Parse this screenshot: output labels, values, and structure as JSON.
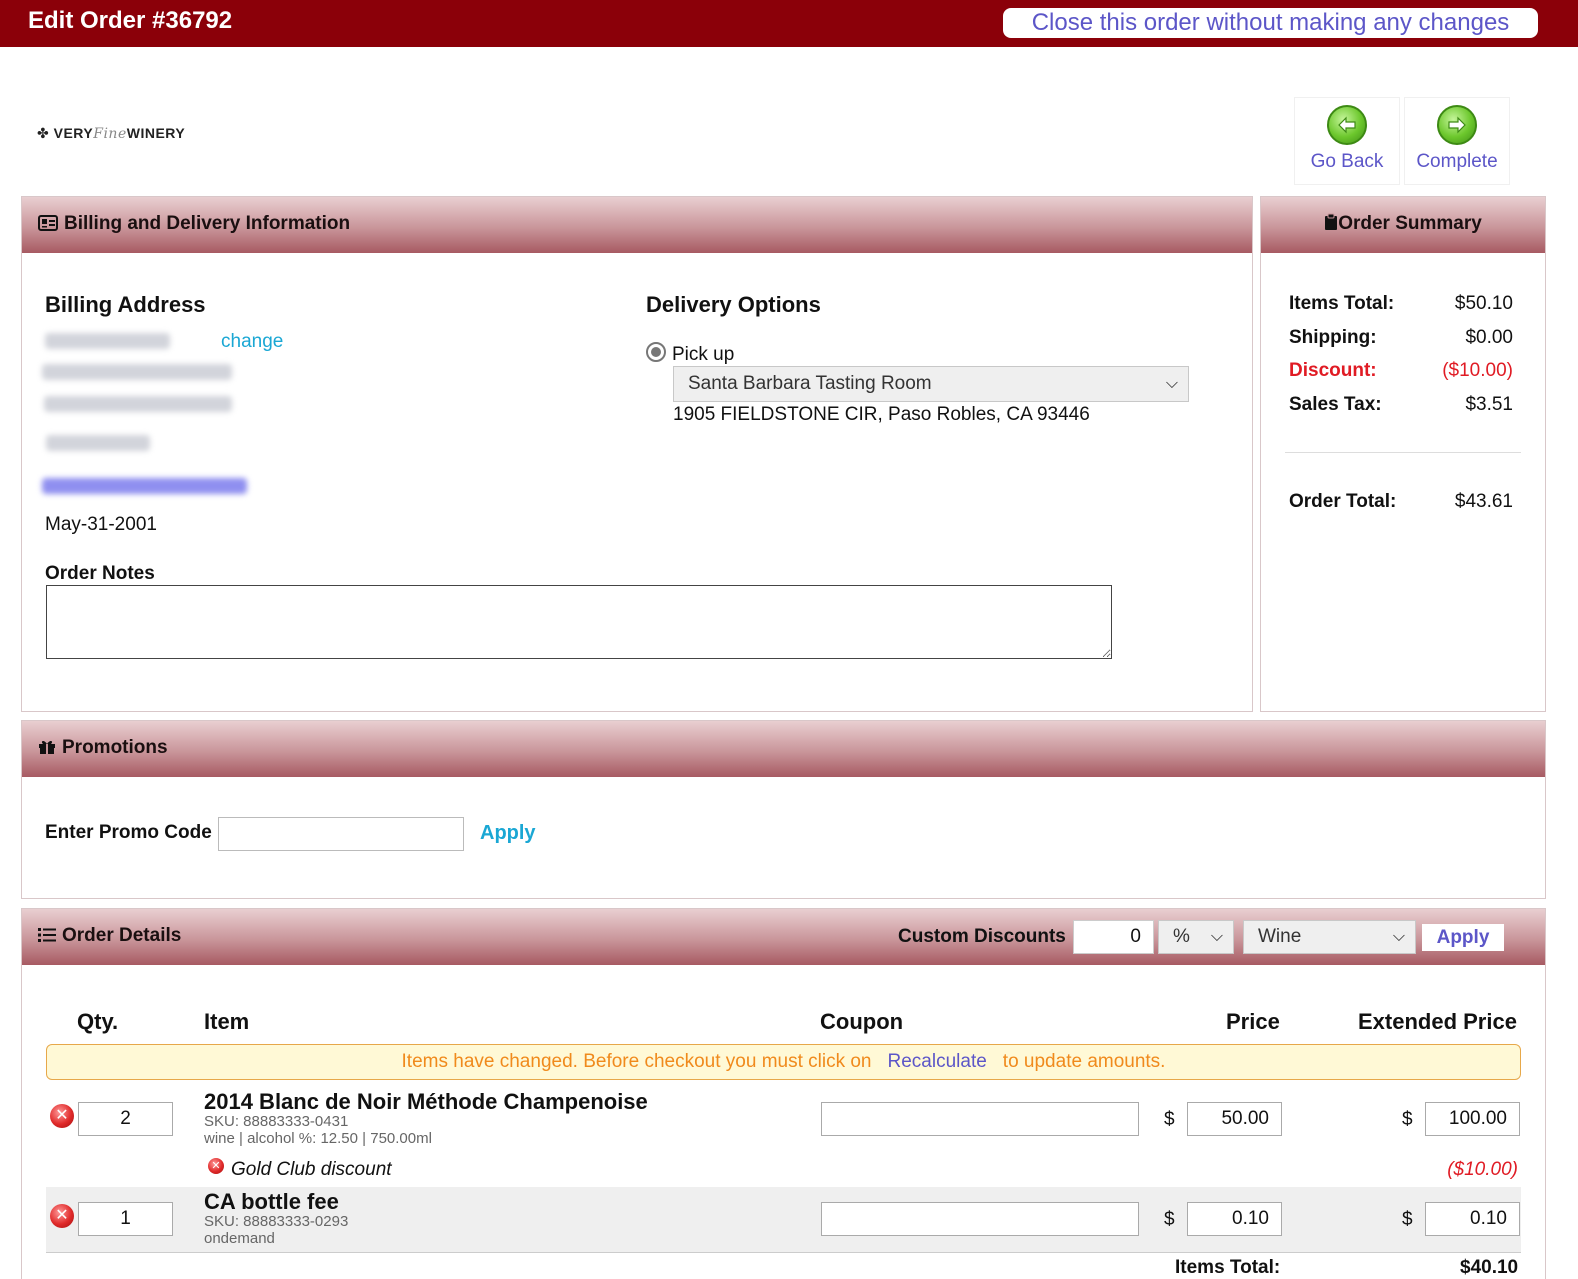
{
  "header": {
    "title": "Edit Order #36792",
    "close_label": "Close this order without making any changes"
  },
  "logo": {
    "part1": "VERY",
    "part2": "Fine",
    "part3": "WINERY"
  },
  "nav": {
    "back_label": "Go Back",
    "complete_label": "Complete"
  },
  "billing_panel": {
    "title": "Billing and Delivery Information",
    "billing_heading": "Billing Address",
    "change_label": "change",
    "date": "May-31-2001",
    "notes_label": "Order Notes",
    "notes_value": ""
  },
  "delivery": {
    "heading": "Delivery Options",
    "option_label": "Pick up",
    "location_selected": "Santa Barbara Tasting Room",
    "address": "1905 FIELDSTONE CIR, Paso Robles, CA 93446"
  },
  "summary": {
    "title": "Order Summary",
    "items_total_label": "Items Total:",
    "items_total_value": "$50.10",
    "shipping_label": "Shipping:",
    "shipping_value": "$0.00",
    "discount_label": "Discount:",
    "discount_value": "($10.00)",
    "tax_label": "Sales Tax:",
    "tax_value": "$3.51",
    "order_total_label": "Order Total:",
    "order_total_value": "$43.61"
  },
  "promotions": {
    "title": "Promotions",
    "promo_label": "Enter Promo Code",
    "promo_value": "",
    "apply_label": "Apply"
  },
  "order_details": {
    "title": "Order Details",
    "custom_discounts_label": "Custom Discounts",
    "discount_amount": "0",
    "discount_type": "%",
    "discount_category": "Wine",
    "apply_label": "Apply",
    "columns": {
      "qty": "Qty.",
      "item": "Item",
      "coupon": "Coupon",
      "price": "Price",
      "extended": "Extended Price"
    },
    "warning_before": "Items have changed. Before checkout you must click on",
    "warning_link": "Recalculate",
    "warning_after": "to update amounts.",
    "currency": "$",
    "items": [
      {
        "qty": "2",
        "name": "2014 Blanc de Noir Méthode Champenoise",
        "sku": "SKU: 88883333-0431",
        "meta": "wine | alcohol %: 12.50 | 750.00ml",
        "coupon": "",
        "price": "50.00",
        "extended": "100.00",
        "discount_name": "Gold Club discount",
        "discount_amount": "($10.00)"
      },
      {
        "qty": "1",
        "name": "CA bottle fee",
        "sku": "SKU: 88883333-0293",
        "meta": "ondemand",
        "coupon": "",
        "price": "0.10",
        "extended": "0.10"
      }
    ],
    "items_total_label": "Items Total:",
    "items_total_value": "$40.10"
  }
}
